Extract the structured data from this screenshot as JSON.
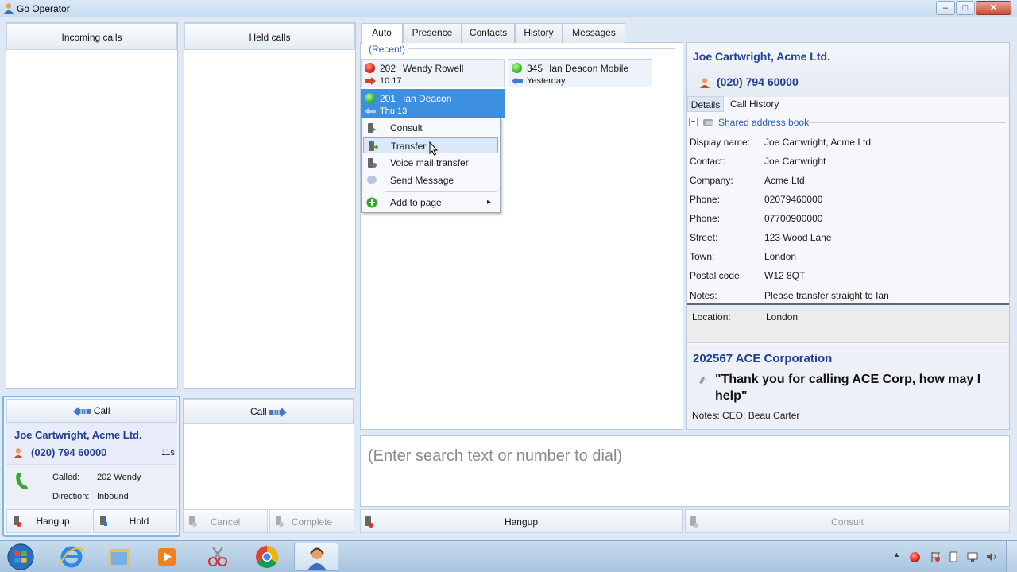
{
  "window": {
    "title": "Go Operator",
    "minimize": "–",
    "maximize": "□",
    "close": "✕"
  },
  "incoming": {
    "header": "Incoming calls"
  },
  "held": {
    "header": "Held calls"
  },
  "active_call": {
    "header": "Call",
    "name": "Joe Cartwright, Acme Ltd.",
    "phone": "(020) 794 60000",
    "duration": "11s",
    "called_label": "Called:",
    "called_value": "202  Wendy",
    "direction_label": "Direction:",
    "direction_value": "Inbound",
    "hangup": "Hangup",
    "hold": "Hold"
  },
  "outgoing": {
    "header": "Call",
    "cancel": "Cancel",
    "complete": "Complete"
  },
  "tabs": [
    "Auto",
    "Presence",
    "Contacts",
    "History",
    "Messages"
  ],
  "recent": {
    "label": "(Recent)",
    "cards": [
      {
        "ext": "202",
        "name": "Wendy Rowell",
        "time": "10:17",
        "status": "red"
      },
      {
        "ext": "345",
        "name": "Ian Deacon Mobile",
        "time": "Yesterday",
        "status": "green"
      },
      {
        "ext": "201",
        "name": "Ian Deacon",
        "time": "Thu 13",
        "status": "green"
      }
    ]
  },
  "context_menu": {
    "items": [
      "Consult",
      "Transfer",
      "Voice mail transfer",
      "Send Message",
      "Add to page"
    ],
    "submenu_arrow": "▸"
  },
  "contact": {
    "name": "Joe Cartwright, Acme Ltd.",
    "phone": "(020) 794 60000",
    "tabs": [
      "Details",
      "Call History"
    ],
    "section": "Shared address book",
    "collapse": "−",
    "fields": [
      {
        "label": "Display name:",
        "value": "Joe Cartwright, Acme Ltd."
      },
      {
        "label": "Contact:",
        "value": "Joe Cartwright"
      },
      {
        "label": "Company:",
        "value": "Acme Ltd."
      },
      {
        "label": "Phone:",
        "value": "02079460000"
      },
      {
        "label": "Phone:",
        "value": "07700900000"
      },
      {
        "label": "Street:",
        "value": "123 Wood Lane"
      },
      {
        "label": "Town:",
        "value": "London"
      },
      {
        "label": "Postal code:",
        "value": "W12 8QT"
      },
      {
        "label": "Notes:",
        "value": "Please transfer straight to Ian"
      }
    ],
    "location_label": "Location:",
    "location_value": "London"
  },
  "ddi": {
    "title": "202567  ACE Corporation",
    "greeting": "\"Thank you for calling ACE Corp, how may I help\"",
    "notes": "Notes: CEO: Beau Carter"
  },
  "search": {
    "placeholder": "(Enter search text or number to dial)"
  },
  "bottom_actions": {
    "hangup": "Hangup",
    "consult": "Consult"
  },
  "taskbar": {
    "apps": [
      "start-orb",
      "internet-explorer",
      "file-explorer",
      "media-player",
      "snipping-tool",
      "chrome",
      "go-operator"
    ]
  },
  "colors": {
    "accent": "#3d8fe0",
    "title_blue": "#1f3f8f",
    "selected": "#3d8fe0"
  }
}
